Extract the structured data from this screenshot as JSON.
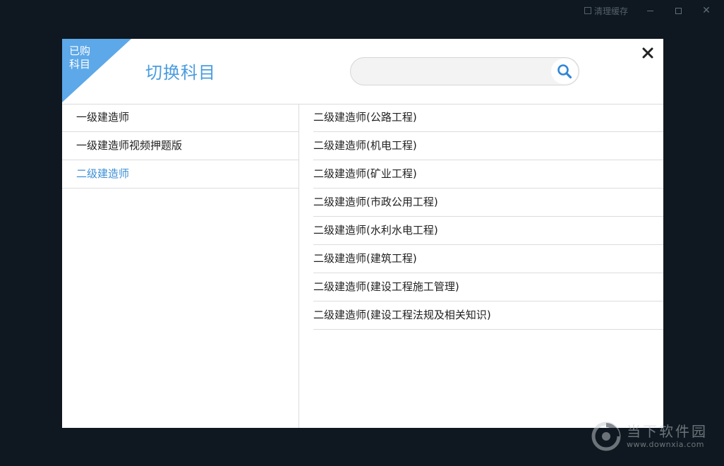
{
  "titlebar": {
    "clear_cache_label": "清理缓存",
    "minimize_symbol": "–",
    "close_symbol": "✕"
  },
  "dialog": {
    "corner_badge": "已购科目",
    "title": "切换科目",
    "search": {
      "value": "",
      "placeholder": ""
    },
    "close_symbol": "✖"
  },
  "left_panel": {
    "items": [
      {
        "label": "一级建造师",
        "active": false
      },
      {
        "label": "一级建造师视频押题版",
        "active": false
      },
      {
        "label": "二级建造师",
        "active": true
      }
    ]
  },
  "right_panel": {
    "items": [
      {
        "label": "二级建造师(公路工程)"
      },
      {
        "label": "二级建造师(机电工程)"
      },
      {
        "label": "二级建造师(矿业工程)"
      },
      {
        "label": "二级建造师(市政公用工程)"
      },
      {
        "label": "二级建造师(水利水电工程)"
      },
      {
        "label": "二级建造师(建筑工程)"
      },
      {
        "label": "二级建造师(建设工程施工管理)"
      },
      {
        "label": "二级建造师(建设工程法规及相关知识)"
      }
    ]
  },
  "watermark": {
    "name": "当下软件园",
    "url": "www.downxia.com"
  },
  "colors": {
    "accent": "#4a9cdf",
    "corner_badge_bg": "#5da8e8",
    "active_item": "#3d8fd6",
    "backdrop": "#0f1820"
  },
  "icons": {
    "search": "search-icon",
    "close": "close-icon"
  }
}
